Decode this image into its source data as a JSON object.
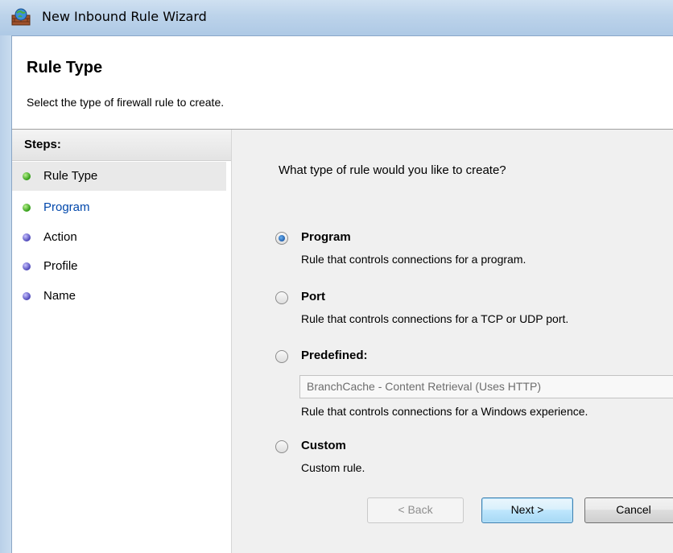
{
  "window": {
    "title": "New Inbound Rule Wizard",
    "icon": "firewall-icon"
  },
  "header": {
    "title": "Rule Type",
    "subtitle": "Select the type of firewall rule to create."
  },
  "steps": {
    "heading": "Steps:",
    "items": [
      {
        "label": "Rule Type",
        "status": "green",
        "active": true
      },
      {
        "label": "Program",
        "status": "green",
        "link": true
      },
      {
        "label": "Action",
        "status": "blue"
      },
      {
        "label": "Profile",
        "status": "blue"
      },
      {
        "label": "Name",
        "status": "blue"
      }
    ]
  },
  "main": {
    "question": "What type of rule would you like to create?",
    "options": [
      {
        "label": "Program",
        "description": "Rule that controls connections for a program.",
        "selected": true
      },
      {
        "label": "Port",
        "description": "Rule that controls connections for a TCP or UDP port.",
        "selected": false
      },
      {
        "label": "Predefined:",
        "description": "Rule that controls connections for a Windows experience.",
        "selected": false
      },
      {
        "label": "Custom",
        "description": "Custom rule.",
        "selected": false
      }
    ],
    "predefined_select_value": "BranchCache - Content Retrieval (Uses HTTP)"
  },
  "buttons": {
    "back": "< Back",
    "next": "Next >",
    "cancel": "Cancel"
  },
  "colors": {
    "step_complete": "#2d9b12",
    "step_pending": "#4b45b7",
    "link": "#0047ab",
    "content_bg": "#f0f0f0"
  }
}
